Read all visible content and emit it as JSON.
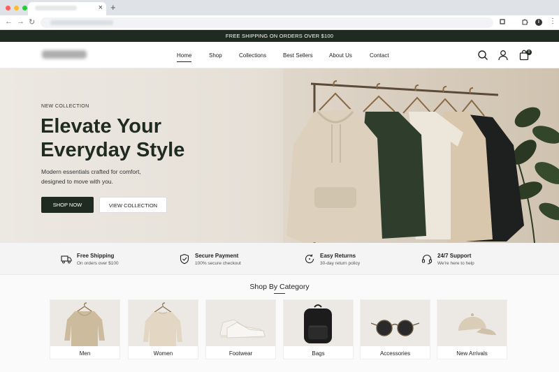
{
  "browser": {
    "close_tab": "×",
    "new_tab": "+",
    "back": "←",
    "forward": "→",
    "reload": "↻",
    "info": "i",
    "menu": "⋮"
  },
  "promo": {
    "text": "FREE SHIPPING ON ORDERS OVER $100"
  },
  "nav": {
    "items": [
      "Home",
      "Shop",
      "Collections",
      "Best Sellers",
      "About Us",
      "Contact"
    ],
    "active": "Home"
  },
  "cart": {
    "count": "0"
  },
  "hero": {
    "kicker": "NEW COLLECTION",
    "title_line1": "Elevate Your",
    "title_line2": "Everyday Style",
    "subtitle_line1": "Modern essentials crafted for comfort,",
    "subtitle_line2": "designed to move with you.",
    "primary_cta": "SHOP NOW",
    "secondary_cta": "VIEW COLLECTION"
  },
  "features": [
    {
      "title": "Free Shipping",
      "subtitle": "On orders over $100",
      "icon": "truck-icon"
    },
    {
      "title": "Secure Payment",
      "subtitle": "100% secure checkout",
      "icon": "shield-check-icon"
    },
    {
      "title": "Easy Returns",
      "subtitle": "30-day return policy",
      "icon": "return-icon"
    },
    {
      "title": "24/7 Support",
      "subtitle": "We're here to help",
      "icon": "headset-icon"
    }
  ],
  "categories": {
    "heading": "Shop By Category",
    "items": [
      {
        "label": "Men",
        "icon": "hoodie-image"
      },
      {
        "label": "Women",
        "icon": "sweater-image"
      },
      {
        "label": "Footwear",
        "icon": "sneaker-image"
      },
      {
        "label": "Bags",
        "icon": "backpack-image"
      },
      {
        "label": "Accessories",
        "icon": "sunglasses-image"
      },
      {
        "label": "New Arrivals",
        "icon": "cap-image"
      }
    ]
  },
  "colors": {
    "brand_dark": "#1f2a21",
    "hero_bg": "#e6e0d7"
  }
}
